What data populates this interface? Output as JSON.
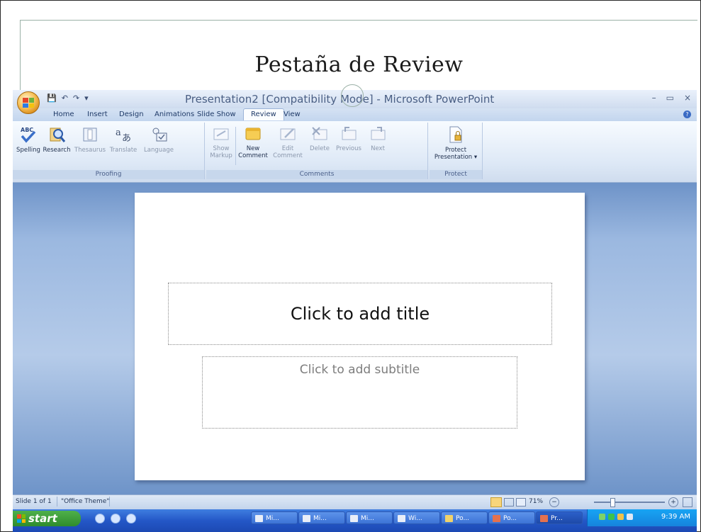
{
  "slide_heading": "Pestaña de Review",
  "window": {
    "title": "Presentation2 [Compatibility Mode] - Microsoft PowerPoint",
    "controls": [
      "–",
      "▭",
      "×"
    ]
  },
  "tabs": [
    "Home",
    "Insert",
    "Design",
    "Animations",
    "Slide Show",
    "Review",
    "View"
  ],
  "active_tab": "Review",
  "ribbon": {
    "proofing": {
      "label": "Proofing",
      "buttons": [
        "Spelling",
        "Research",
        "Thesaurus",
        "Translate",
        "Language"
      ]
    },
    "comments": {
      "label": "Comments",
      "show_markup": "Show Markup",
      "new_comment": "New Comment",
      "edit_comment": "Edit Comment",
      "delete": "Delete",
      "previous": "Previous",
      "next": "Next"
    },
    "protect": {
      "label": "Protect",
      "protect_presentation": "Protect Presentation ▾"
    }
  },
  "slide": {
    "title_placeholder": "Click to add title",
    "subtitle_placeholder": "Click to add subtitle"
  },
  "statusbar": {
    "slide_info": "Slide 1 of 1",
    "theme": "\"Office Theme\"",
    "zoom": "71%"
  },
  "taskbar": {
    "start_label": "start",
    "tasks": [
      "Mi...",
      "Mi...",
      "Mi...",
      "Wi...",
      "Po...",
      "Po...",
      "Pr..."
    ],
    "clock": "9:39 AM"
  }
}
